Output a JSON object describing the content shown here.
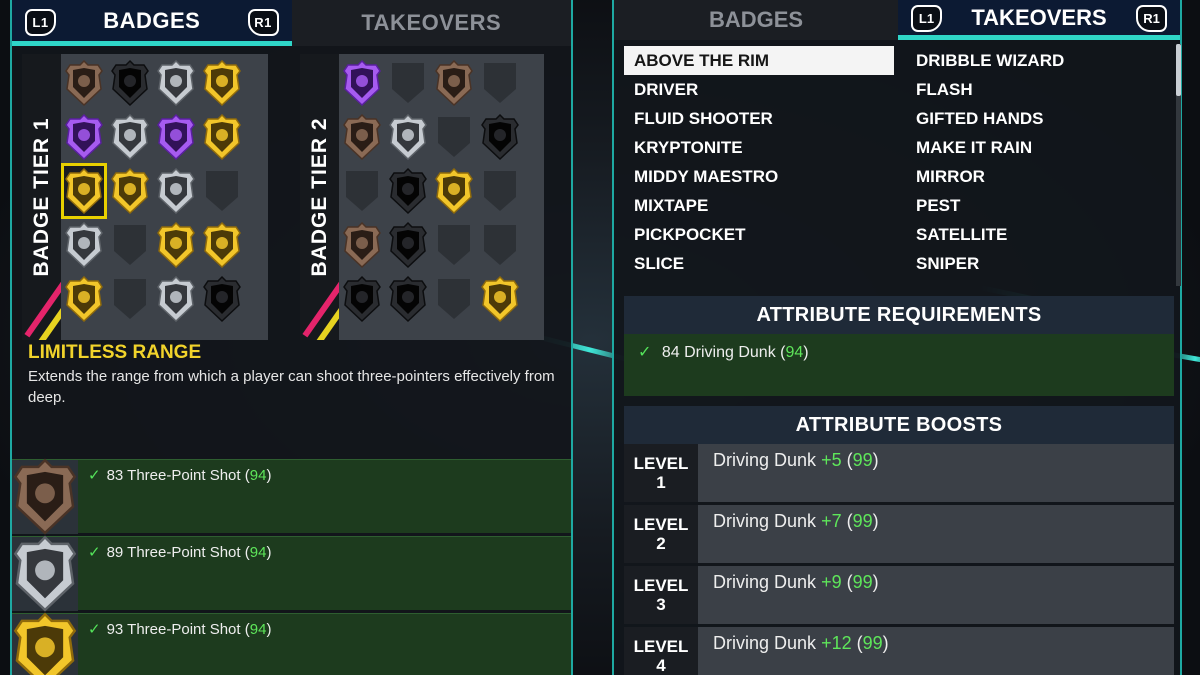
{
  "left": {
    "tabs": [
      {
        "label": "BADGES",
        "active": true,
        "left_button": "L1",
        "right_button": "R1"
      },
      {
        "label": "TAKEOVERS",
        "active": false
      }
    ],
    "tier1": {
      "label": "BADGE TIER 1",
      "badges": [
        "bronze",
        "onyx",
        "silver",
        "gold",
        "purple",
        "silver",
        "purple",
        "gold",
        "gold-selected",
        "gold",
        "silver",
        "empty",
        "silver",
        "empty",
        "gold",
        "gold",
        "gold",
        "empty",
        "silver",
        "onyx"
      ]
    },
    "tier2": {
      "label": "BADGE TIER 2",
      "badges": [
        "purple",
        "empty",
        "bronze",
        "empty",
        "bronze",
        "silver",
        "empty",
        "onyx",
        "empty",
        "onyx",
        "gold",
        "empty",
        "bronze",
        "onyx",
        "empty",
        "empty",
        "onyx",
        "onyx",
        "empty",
        "gold"
      ]
    },
    "selected_badge": {
      "name": "LIMITLESS RANGE",
      "description": "Extends the range from which a player can shoot three-pointers effectively from deep."
    },
    "requirements": [
      {
        "badge": "bronze",
        "value": "83",
        "attribute": "Three-Point Shot",
        "current": "94"
      },
      {
        "badge": "silver",
        "value": "89",
        "attribute": "Three-Point Shot",
        "current": "94"
      },
      {
        "badge": "gold",
        "value": "93",
        "attribute": "Three-Point Shot",
        "current": "94"
      }
    ],
    "check_glyph": "✓"
  },
  "right": {
    "tabs": [
      {
        "label": "BADGES",
        "active": false
      },
      {
        "label": "TAKEOVERS",
        "active": true,
        "left_button": "L1",
        "right_button": "R1"
      }
    ],
    "takeovers_col1": [
      "ABOVE THE RIM",
      "DRIVER",
      "FLUID SHOOTER",
      "KRYPTONITE",
      "MIDDY MAESTRO",
      "MIXTAPE",
      "PICKPOCKET",
      "SLICE"
    ],
    "takeovers_col2": [
      "DRIBBLE WIZARD",
      "FLASH",
      "GIFTED HANDS",
      "MAKE IT RAIN",
      "MIRROR",
      "PEST",
      "SATELLITE",
      "SNIPER"
    ],
    "selected_takeover": "ABOVE THE RIM",
    "attribute_requirements": {
      "title": "ATTRIBUTE REQUIREMENTS",
      "items": [
        {
          "value": "84",
          "attribute": "Driving Dunk",
          "current": "94"
        }
      ]
    },
    "attribute_boosts": {
      "title": "ATTRIBUTE BOOSTS",
      "level_word": "LEVEL",
      "levels": [
        {
          "level": "1",
          "attribute": "Driving Dunk",
          "boost": "+5",
          "result": "99"
        },
        {
          "level": "2",
          "attribute": "Driving Dunk",
          "boost": "+7",
          "result": "99"
        },
        {
          "level": "3",
          "attribute": "Driving Dunk",
          "boost": "+9",
          "result": "99"
        },
        {
          "level": "4",
          "attribute": "Driving Dunk",
          "boost": "+12",
          "result": "99"
        }
      ]
    }
  },
  "colors": {
    "accent": "#2fd6c8",
    "highlight_yellow": "#f1d32b",
    "check_green": "#54e35a",
    "requirement_bg": "#1d3b1e",
    "gold": "#e7b51c",
    "silver": "#a7acb2",
    "bronze": "#7b5a45",
    "purple": "#8a3fd8",
    "onyx": "#111214"
  }
}
